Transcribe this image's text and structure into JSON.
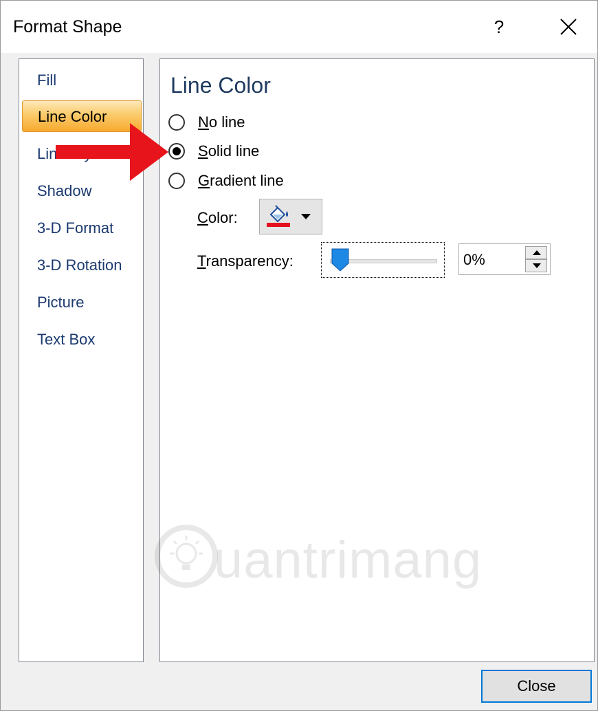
{
  "window": {
    "title": "Format Shape",
    "help_label": "?",
    "close_icon": "close-icon"
  },
  "nav": {
    "items": [
      {
        "label": "Fill",
        "selected": false
      },
      {
        "label": "Line Color",
        "selected": true
      },
      {
        "label": "Line Style",
        "selected": false
      },
      {
        "label": "Shadow",
        "selected": false
      },
      {
        "label": "3-D Format",
        "selected": false
      },
      {
        "label": "3-D Rotation",
        "selected": false
      },
      {
        "label": "Picture",
        "selected": false
      },
      {
        "label": "Text Box",
        "selected": false
      }
    ]
  },
  "content": {
    "title": "Line Color",
    "options": {
      "no_line": {
        "accel": "N",
        "rest": "o line",
        "checked": false
      },
      "solid_line": {
        "accel": "S",
        "rest": "olid line",
        "checked": true
      },
      "gradient_line": {
        "accel": "G",
        "rest": "radient line",
        "checked": false
      }
    },
    "color": {
      "accel": "C",
      "rest": "olor:",
      "swatch": "#e4101f",
      "icon": "paint-bucket-icon"
    },
    "transparency": {
      "accel": "T",
      "rest": "ransparency:",
      "value": "0%",
      "level": 0
    }
  },
  "footer": {
    "close_label": "Close"
  },
  "watermark": {
    "text": "uantrimang",
    "icon": "lightbulb-icon"
  },
  "annotation": {
    "color": "#e8141c",
    "icon": "red-arrow-icon"
  }
}
